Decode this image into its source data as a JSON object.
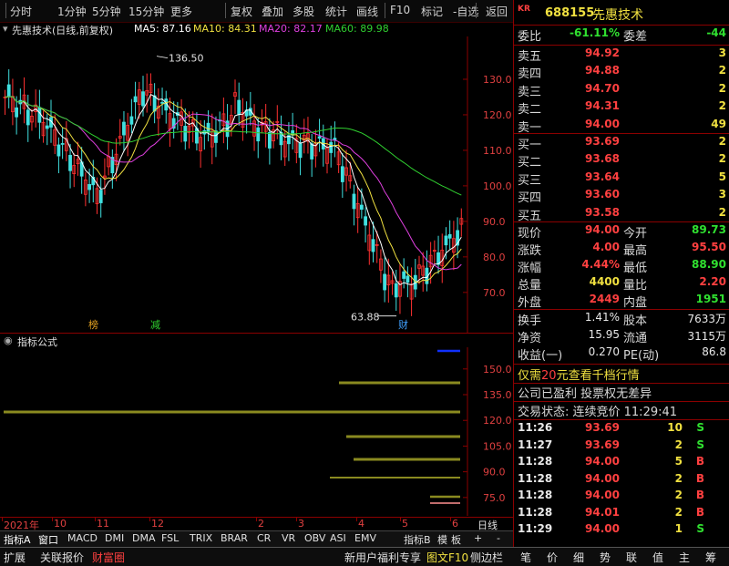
{
  "toolbar": {
    "items": [
      "分时",
      "1分钟",
      "5分钟",
      "15分钟",
      "更多",
      "复权",
      "叠加",
      "多股",
      "统计",
      "画线",
      "F10",
      "标记",
      "-自选",
      "返回"
    ]
  },
  "chart_header": {
    "title": "先惠技术(日线,前复权)",
    "ma5": "MA5: 87.16",
    "ma10": "MA10: 84.31",
    "ma20": "MA20: 82.17",
    "ma60": "MA60: 89.98",
    "ma5_color": "#ffffff",
    "ma10_color": "#f0e040",
    "ma20_color": "#e040e0",
    "ma60_color": "#30d030"
  },
  "annotations": {
    "high": "136.50",
    "low": "63.88",
    "badge1": "榜",
    "badge2": "减",
    "badge3": "财"
  },
  "indicator_header": {
    "title": "指标公式"
  },
  "chart_data": {
    "type": "candlestick",
    "y_ticks": [
      "130.0",
      "120.0",
      "110.0",
      "100.0",
      "90.0",
      "80.0",
      "70.0"
    ],
    "ylim": [
      62,
      140
    ],
    "indicator_ticks": [
      "150.0",
      "135.0",
      "120.0",
      "105.0",
      "90.0",
      "75.0"
    ],
    "indicator_ylim": [
      68,
      160
    ],
    "x_labels": [
      "2021年",
      "10",
      "11",
      "12",
      "2",
      "3",
      "4",
      "5",
      "6"
    ],
    "x_right_label": "日线",
    "high_point": 136.5,
    "low_point": 63.88
  },
  "tabs": {
    "items": [
      "指标A",
      "窗口",
      "MACD",
      "DMI",
      "DMA",
      "FSL",
      "TRIX",
      "BRAR",
      "CR",
      "VR",
      "OBV",
      "ASI",
      "EMV"
    ],
    "right_items": [
      "指标B",
      "模",
      "板",
      "+",
      "-"
    ]
  },
  "status_bar": {
    "left": [
      "扩展",
      "关联报价",
      "财富圈"
    ],
    "mid": [
      "新用户福利专享",
      "图文F10",
      "侧边栏"
    ],
    "right": [
      "笔",
      "价",
      "细",
      "势",
      "联",
      "值",
      "主",
      "筹"
    ]
  },
  "quote": {
    "market_tag": "KR",
    "code": "688155",
    "name": "先惠技术",
    "webi_label": "委比",
    "webi": "-61.11%",
    "weicha_label": "委差",
    "weicha": "-44",
    "asks": [
      {
        "label": "卖五",
        "price": "94.92",
        "vol": "3"
      },
      {
        "label": "卖四",
        "price": "94.88",
        "vol": "2"
      },
      {
        "label": "卖三",
        "price": "94.70",
        "vol": "2"
      },
      {
        "label": "卖二",
        "price": "94.31",
        "vol": "2"
      },
      {
        "label": "卖一",
        "price": "94.00",
        "vol": "49"
      }
    ],
    "bids": [
      {
        "label": "买一",
        "price": "93.69",
        "vol": "2"
      },
      {
        "label": "买二",
        "price": "93.68",
        "vol": "2"
      },
      {
        "label": "买三",
        "price": "93.64",
        "vol": "5"
      },
      {
        "label": "买四",
        "price": "93.60",
        "vol": "3"
      },
      {
        "label": "买五",
        "price": "93.58",
        "vol": "2"
      }
    ],
    "stats": [
      {
        "l1": "现价",
        "v1": "94.00",
        "c1": "red",
        "l2": "今开",
        "v2": "89.73",
        "c2": "grn"
      },
      {
        "l1": "涨跌",
        "v1": "4.00",
        "c1": "red",
        "l2": "最高",
        "v2": "95.50",
        "c2": "red"
      },
      {
        "l1": "涨幅",
        "v1": "4.44%",
        "c1": "red",
        "l2": "最低",
        "v2": "88.90",
        "c2": "grn"
      },
      {
        "l1": "总量",
        "v1": "4400",
        "c1": "yel",
        "l2": "量比",
        "v2": "2.20",
        "c2": "red"
      },
      {
        "l1": "外盘",
        "v1": "2449",
        "c1": "red",
        "l2": "内盘",
        "v2": "1951",
        "c2": "grn"
      }
    ],
    "fund": [
      {
        "l1": "换手",
        "v1": "1.41%",
        "l2": "股本",
        "v2": "7633万"
      },
      {
        "l1": "净资",
        "v1": "15.95",
        "l2": "流通",
        "v2": "3115万"
      },
      {
        "l1": "收益(一)",
        "v1": "0.270",
        "l2": "PE(动)",
        "v2": "86.8"
      }
    ],
    "promo1a": "仅需",
    "promo1b": "20",
    "promo1c": "元查看千档行情",
    "promo2": "公司已盈利 投票权无差异",
    "trade_status": "交易状态: 连续竞价 11:29:41",
    "ticks": [
      {
        "t": "11:26",
        "p": "93.69",
        "pc": "red",
        "v": "10",
        "s": "S"
      },
      {
        "t": "11:27",
        "p": "93.69",
        "pc": "red",
        "v": "2",
        "s": "S"
      },
      {
        "t": "11:28",
        "p": "94.00",
        "pc": "red",
        "v": "5",
        "s": "B"
      },
      {
        "t": "11:28",
        "p": "94.00",
        "pc": "red",
        "v": "2",
        "s": "B"
      },
      {
        "t": "11:28",
        "p": "94.00",
        "pc": "red",
        "v": "2",
        "s": "B"
      },
      {
        "t": "11:28",
        "p": "94.01",
        "pc": "red",
        "v": "2",
        "s": "B"
      },
      {
        "t": "11:29",
        "p": "94.00",
        "pc": "red",
        "v": "1",
        "s": "S"
      }
    ]
  }
}
